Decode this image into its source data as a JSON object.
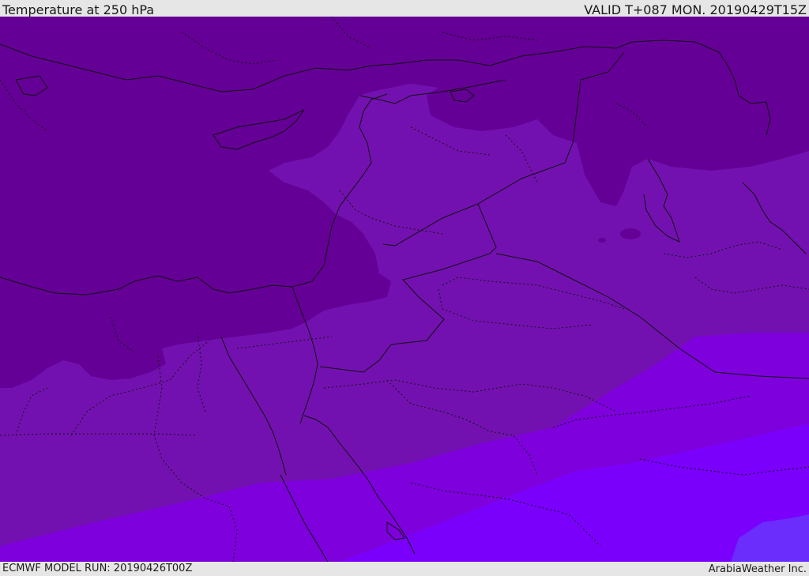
{
  "header": {
    "title": "Temperature at 250 hPa",
    "valid": "VALID T+087 MON. 20190429T15Z"
  },
  "footer": {
    "model_run": "ECMWF MODEL RUN: 20190426T00Z",
    "credit": "ArabiaWeather Inc."
  },
  "map": {
    "field": "Temperature at 250 hPa",
    "colors": {
      "coldest": "#650096",
      "cold": "#7311b0",
      "mid": "#7e00dc",
      "warm": "#7a00fc",
      "warmest": "#6a2dfc",
      "boundaries": "#111111"
    }
  }
}
